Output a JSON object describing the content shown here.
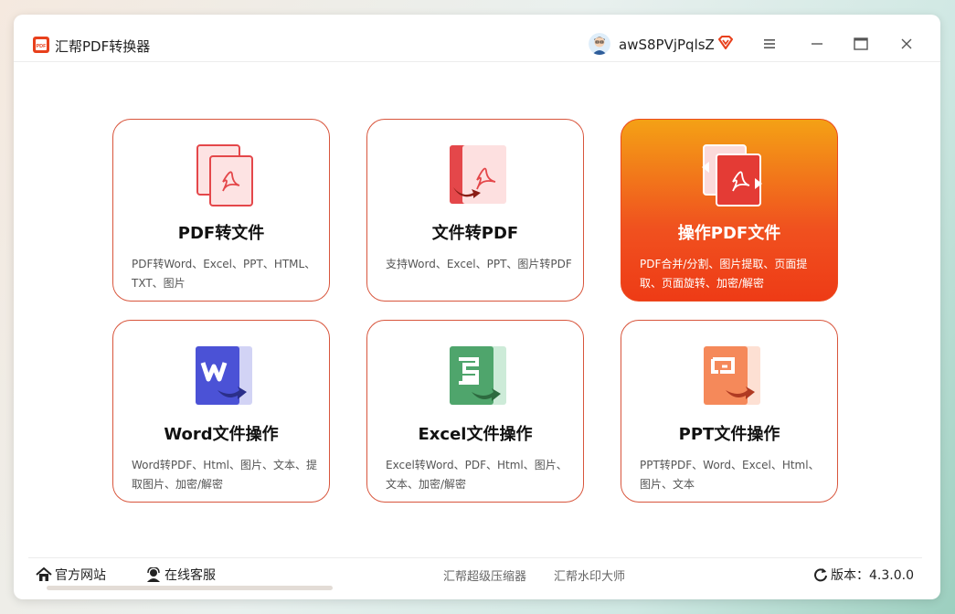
{
  "app": {
    "title": "汇帮PDF转换器",
    "username": "awS8PVjPqlsZ"
  },
  "titlebar": {
    "icons": [
      "pdf-logo-icon",
      "avatar",
      "vip-diamond-icon",
      "menu-icon",
      "minimize-icon",
      "maximize-icon",
      "close-icon"
    ]
  },
  "cards": [
    {
      "title": "PDF转文件",
      "desc": "PDF转Word、Excel、PPT、HTML、TXT、图片",
      "icon": "pdf-file-icon"
    },
    {
      "title": "文件转PDF",
      "desc": "支持Word、Excel、PPT、图片转PDF",
      "icon": "file-to-pdf-icon"
    },
    {
      "title": "操作PDF文件",
      "desc": "PDF合并/分割、图片提取、页面提取、页面旋转、加密/解密",
      "icon": "pdf-operate-icon",
      "active": true
    },
    {
      "title": "Word文件操作",
      "desc": "Word转PDF、Html、图片、文本、提取图片、加密/解密",
      "icon": "word-icon"
    },
    {
      "title": "Excel文件操作",
      "desc": "Excel转Word、PDF、Html、图片、文本、加密/解密",
      "icon": "excel-icon"
    },
    {
      "title": "PPT文件操作",
      "desc": "PPT转PDF、Word、Excel、Html、图片、文本",
      "icon": "ppt-icon"
    }
  ],
  "footer": {
    "website": "官方网站",
    "support": "在线客服",
    "link1": "汇帮超级压缩器",
    "link2": "汇帮水印大师",
    "version": "版本：4.3.0.0"
  },
  "colors": {
    "accent": "#ef4a1f",
    "accent_light": "#f4a115",
    "border": "#d8553c",
    "word": "#4b52d6",
    "excel": "#4fa56c",
    "ppt": "#f06a3c"
  }
}
